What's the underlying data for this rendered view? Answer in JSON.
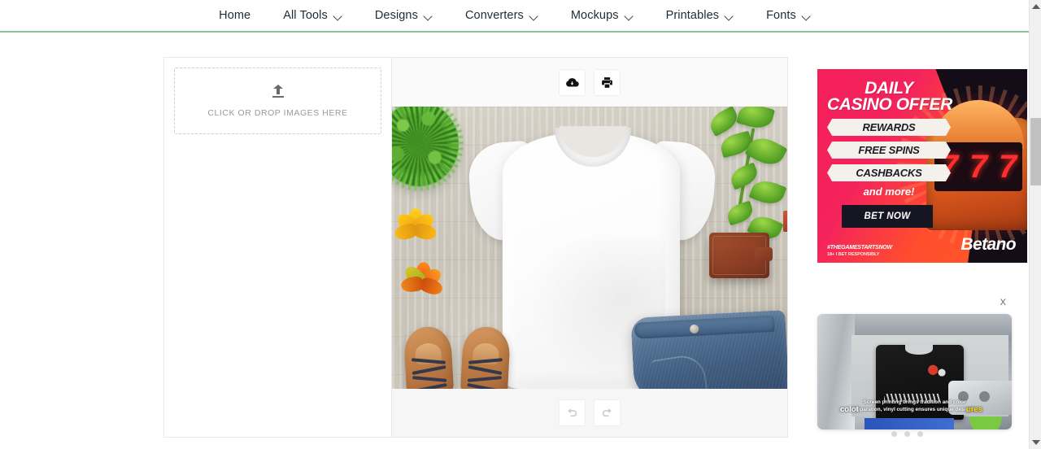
{
  "nav": {
    "items": [
      {
        "label": "Home",
        "has_dropdown": false,
        "icon": ""
      },
      {
        "label": "All Tools",
        "has_dropdown": true,
        "icon": "chevron-down-icon"
      },
      {
        "label": "Designs",
        "has_dropdown": true,
        "icon": "chevron-down-icon"
      },
      {
        "label": "Converters",
        "has_dropdown": true,
        "icon": "chevron-down-icon"
      },
      {
        "label": "Mockups",
        "has_dropdown": true,
        "icon": "chevron-down-icon"
      },
      {
        "label": "Printables",
        "has_dropdown": true,
        "icon": "chevron-down-icon"
      },
      {
        "label": "Fonts",
        "has_dropdown": true,
        "icon": "chevron-down-icon"
      }
    ],
    "accent_color": "#8fc68f"
  },
  "editor": {
    "upload": {
      "icon": "upload-icon",
      "text": "CLICK OR DROP IMAGES HERE"
    },
    "toolbar": {
      "download_icon": "cloud-download-icon",
      "print_icon": "printer-icon"
    },
    "history": {
      "undo_icon": "undo-arrow-icon",
      "redo_icon": "redo-arrow-icon"
    },
    "preview": {
      "alt": "white blank t-shirt mockup flat lay on weathered wood with autumn leaves, sneakers, jeans, wallet and green plants",
      "sevens": [
        "7",
        "7",
        "7"
      ]
    }
  },
  "ads": {
    "casino": {
      "title_line1": "DAILY",
      "title_line2": "CASINO OFFER",
      "ribbons": [
        "REWARDS",
        "FREE SPINS",
        "CASHBACKS"
      ],
      "and_more": "and more!",
      "cta": "BET NOW",
      "hashtag": "#THEGAMESTARTSNOW",
      "responsibly": "18+ I BET RESPONSIBLY",
      "brand": "Betano",
      "colors": {
        "pink": "#f51f5a",
        "orange": "#ff5a25",
        "dark": "#140d18"
      }
    },
    "video": {
      "close_label": "X",
      "caption_line1": "Screen printing brings tradition and color",
      "caption_line2": "separation, vinyl cutting ensures unique designs",
      "overlay_word_left": "colot",
      "overlay_word_right": "ures",
      "dots": [
        "dot-1",
        "dot-2",
        "dot-3"
      ]
    }
  },
  "scrollbar": {
    "up_icon": "scroll-up-arrow-icon",
    "down_icon": "scroll-down-arrow-icon",
    "thumb": "scrollbar-thumb"
  }
}
